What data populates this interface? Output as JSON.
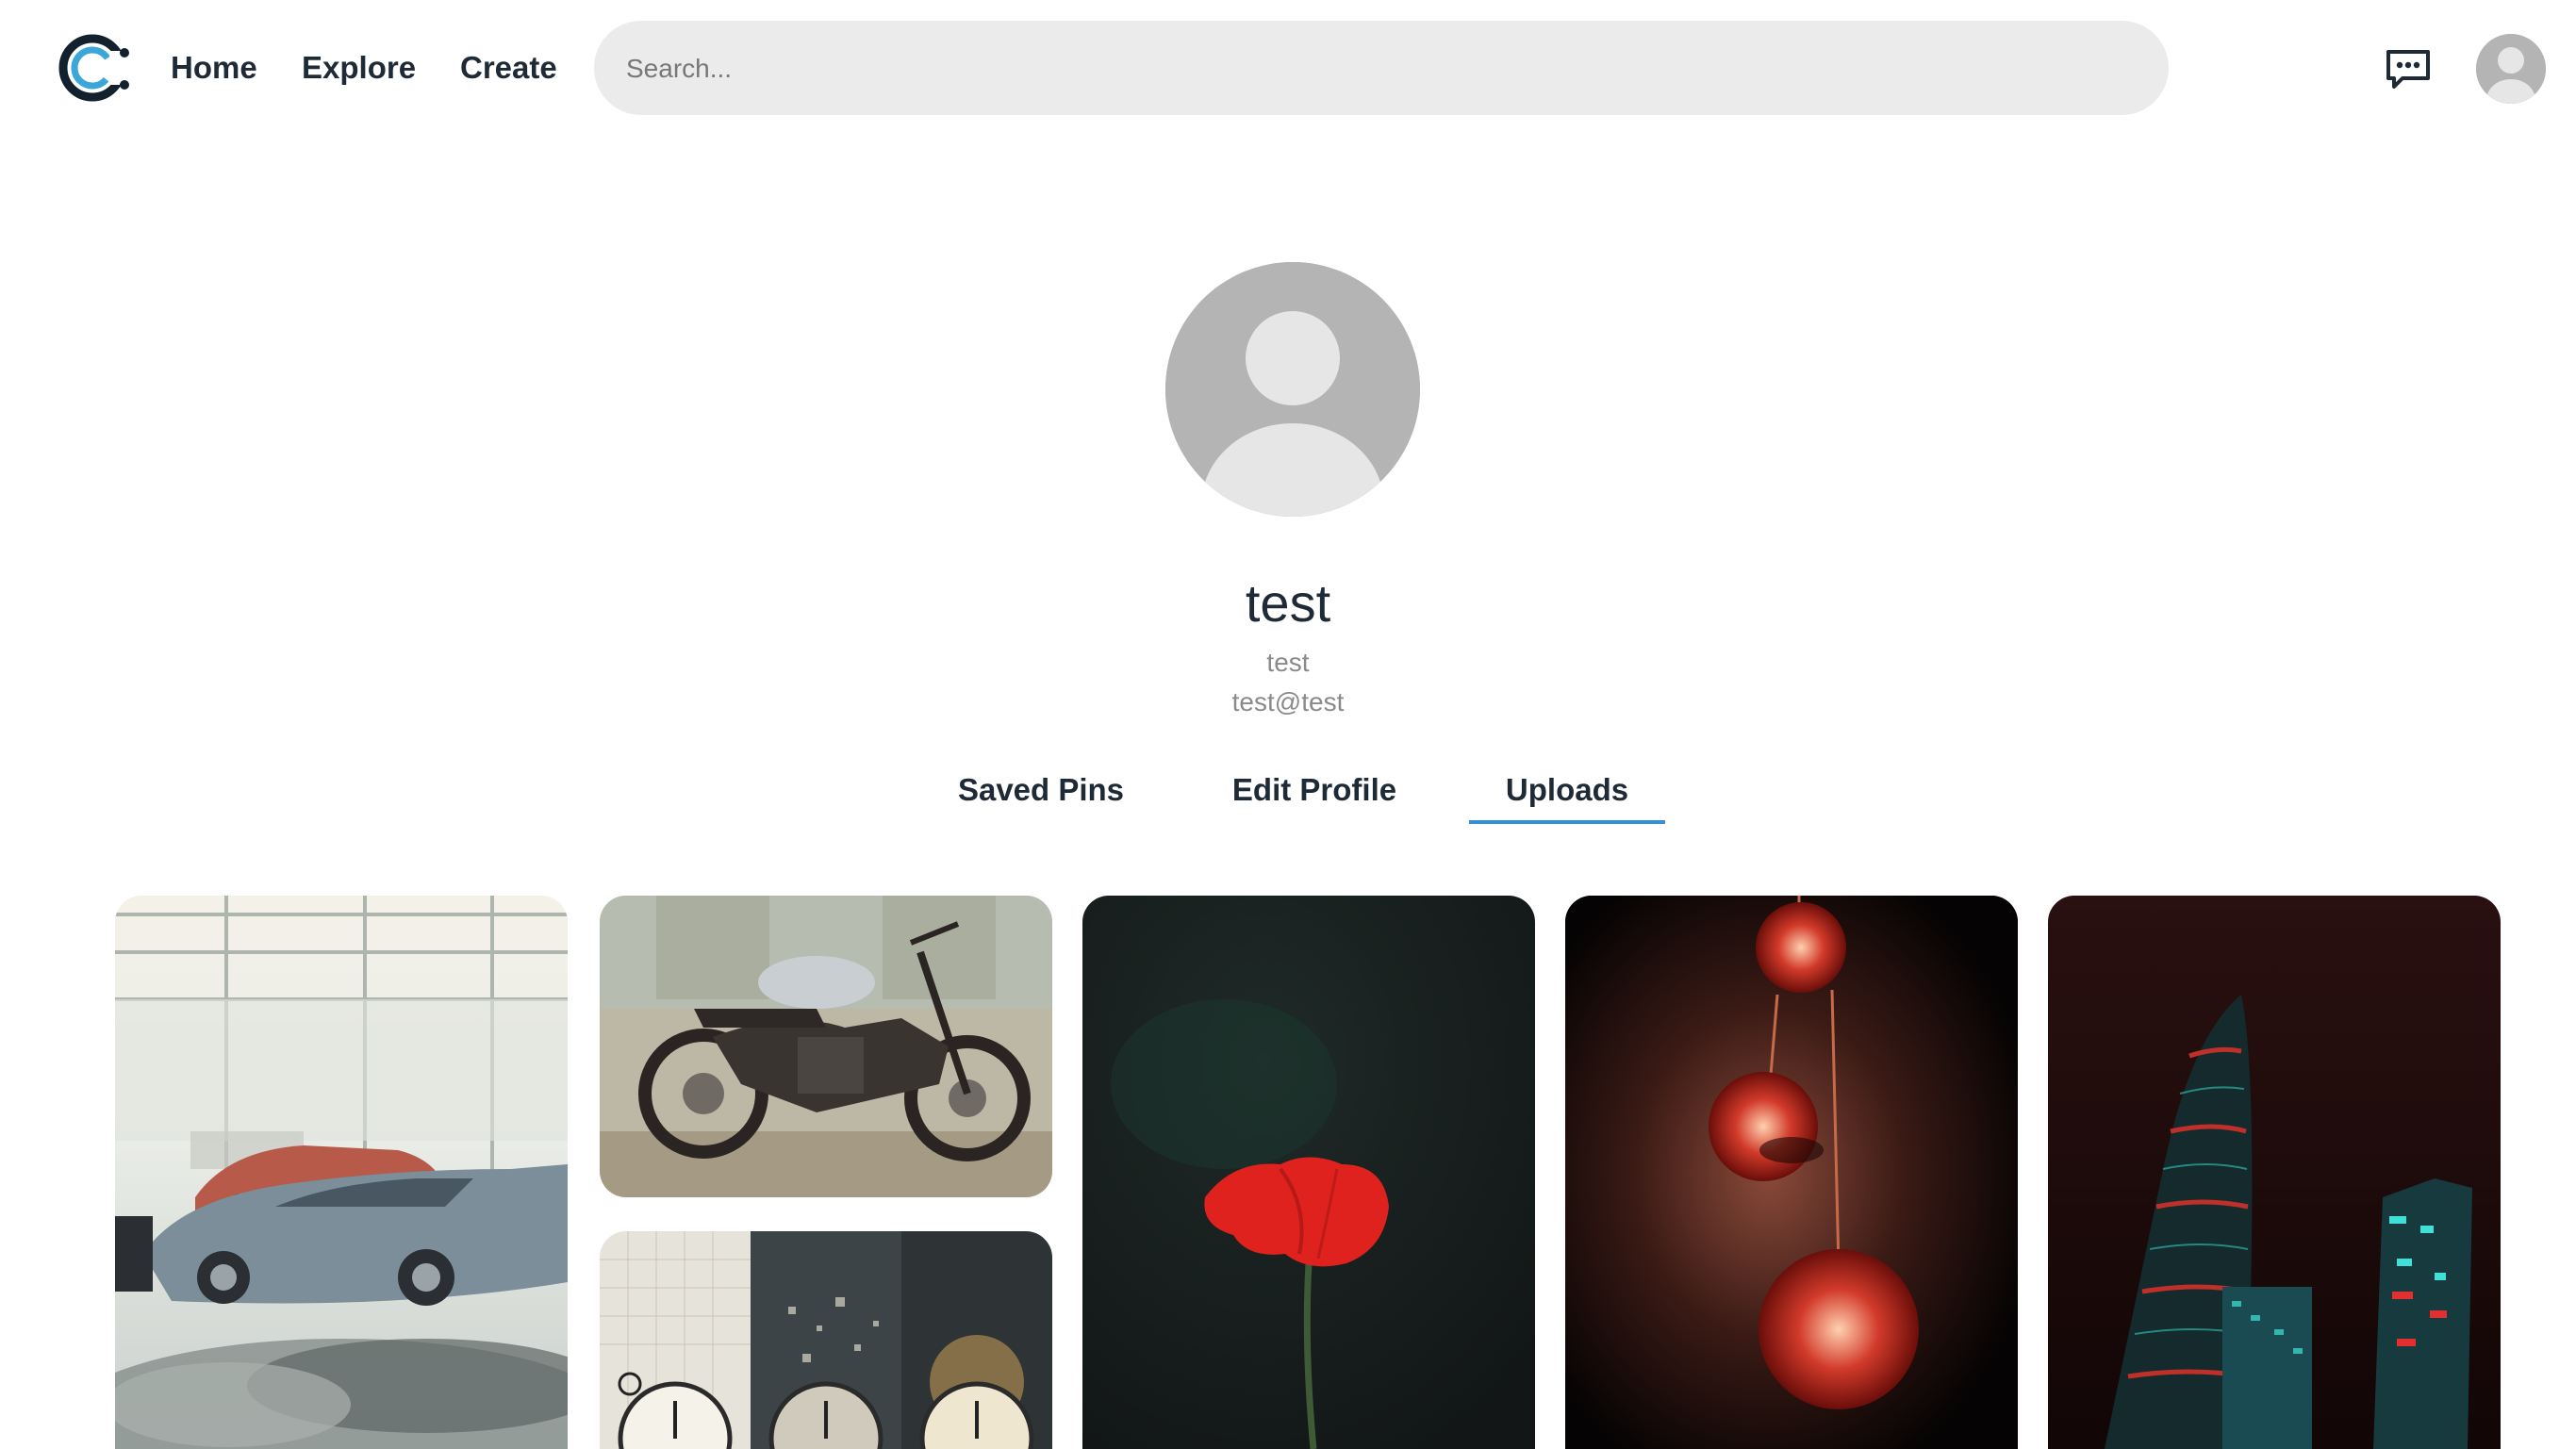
{
  "nav": {
    "home_label": "Home",
    "explore_label": "Explore",
    "create_label": "Create"
  },
  "search": {
    "placeholder": "Search..."
  },
  "profile": {
    "display_name": "test",
    "username": "test",
    "email": "test@test"
  },
  "tabs": [
    {
      "label": "Saved Pins",
      "active": false
    },
    {
      "label": "Edit Profile",
      "active": false
    },
    {
      "label": "Uploads",
      "active": true
    }
  ],
  "icons": {
    "logo": "logo-icon",
    "messages": "chat-bubble-icon",
    "user": "user-avatar-icon"
  },
  "colors": {
    "accent": "#3a8fd0",
    "text": "#1f2a37",
    "muted": "#8a8a8a",
    "search_bg": "#ebebeb",
    "avatar_bg": "#b4b4b4"
  },
  "pins": [
    {
      "subject": "cars-showroom"
    },
    {
      "subject": "motorcycle"
    },
    {
      "subject": "clocks-triptych"
    },
    {
      "subject": "red-poppy"
    },
    {
      "subject": "hanging-lamps"
    },
    {
      "subject": "night-skyscrapers"
    }
  ]
}
